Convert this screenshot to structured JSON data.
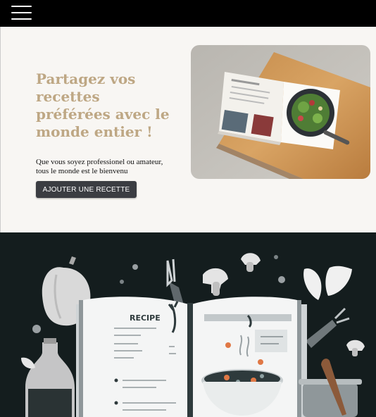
{
  "nav": {
    "menu_icon": "hamburger-menu-icon"
  },
  "hero": {
    "title": "Partagez vos recettes préférées avec le monde entier !",
    "subtitle": "Que vous soyez professionel ou amateur, tous le monde est le bienvenu",
    "cta_label": "AJOUTER UNE RECETTE"
  },
  "illustration": {
    "book_label": "RECIPE"
  },
  "colors": {
    "title": "#bea784",
    "button": "#3b3d42",
    "dark_bg": "#141d1e",
    "topbar": "#000000"
  }
}
